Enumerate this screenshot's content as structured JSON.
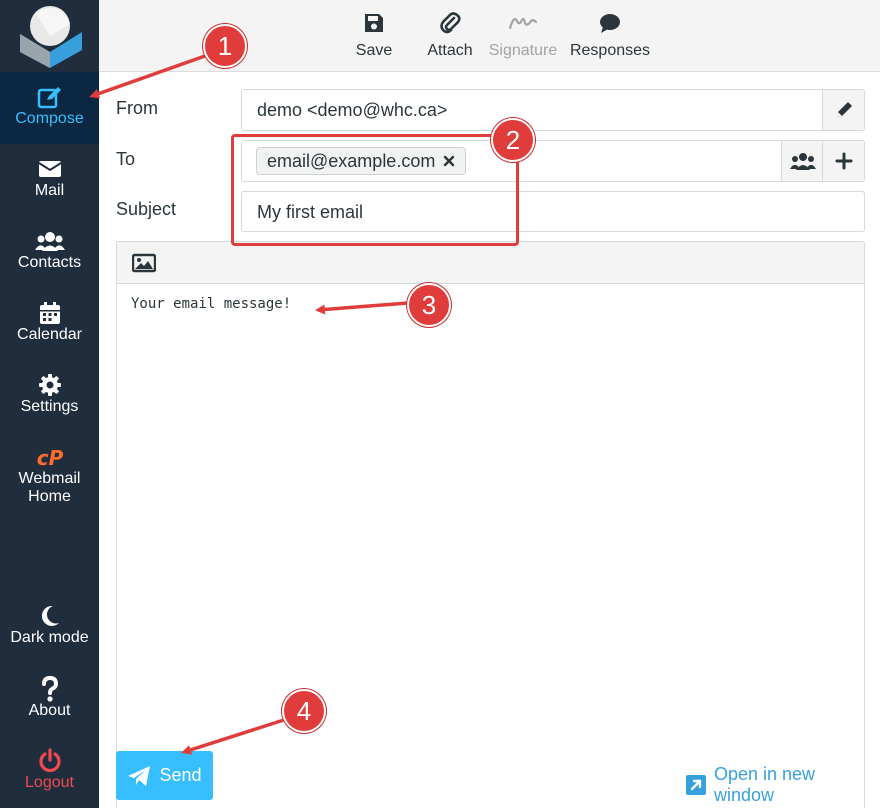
{
  "sidebar": {
    "items": [
      {
        "label": "Compose",
        "icon": "compose-icon"
      },
      {
        "label": "Mail",
        "icon": "envelope-icon"
      },
      {
        "label": "Contacts",
        "icon": "users-icon"
      },
      {
        "label": "Calendar",
        "icon": "calendar-icon"
      },
      {
        "label": "Settings",
        "icon": "gear-icon"
      },
      {
        "label": "Webmail Home",
        "icon": "cpanel-icon"
      },
      {
        "label": "Dark mode",
        "icon": "moon-icon"
      },
      {
        "label": "About",
        "icon": "question-icon"
      },
      {
        "label": "Logout",
        "icon": "power-icon"
      }
    ],
    "active": "Compose"
  },
  "toolbar": {
    "save": "Save",
    "attach": "Attach",
    "signature": "Signature",
    "responses": "Responses"
  },
  "form": {
    "from_label": "From",
    "from_value": "demo <demo@whc.ca>",
    "to_label": "To",
    "to_recipient": "email@example.com",
    "subject_label": "Subject",
    "subject_value": "My first email"
  },
  "editor": {
    "body": "Your email message!"
  },
  "actions": {
    "send": "Send",
    "open_new_window": "Open in new window"
  },
  "annotations": {
    "callouts": [
      "1",
      "2",
      "3",
      "4"
    ]
  },
  "colors": {
    "sidebar_bg": "#1f2d3d",
    "accent": "#37beff",
    "logout": "#f1494f",
    "annotation_red": "#e03c3c"
  }
}
